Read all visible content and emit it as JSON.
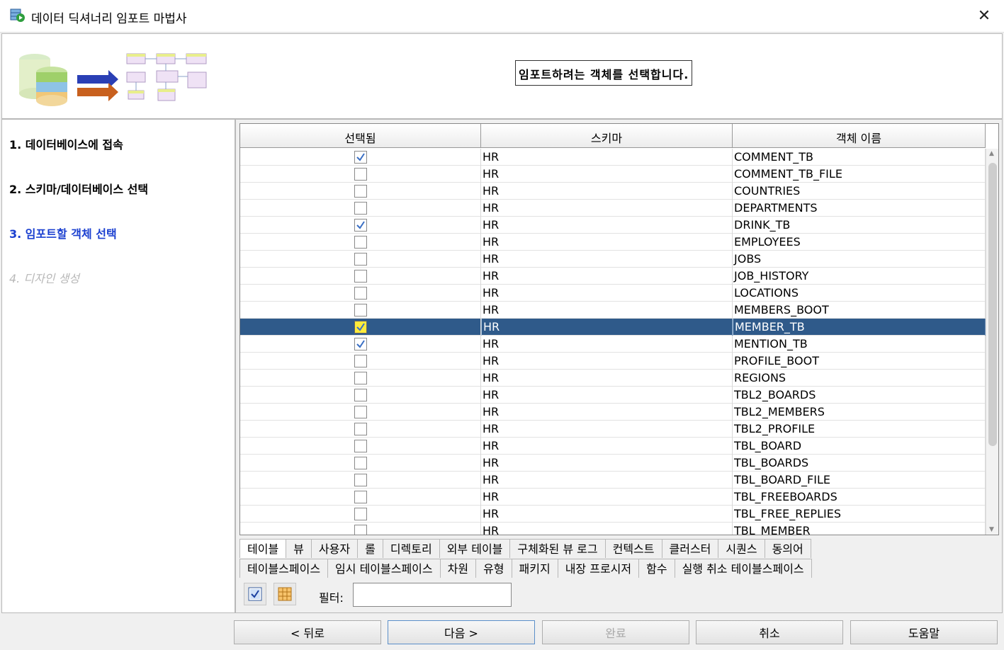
{
  "window": {
    "title": "데이터 딕셔너리 임포트 마법사"
  },
  "header": {
    "instruction": "임포트하려는 객체를 선택합니다."
  },
  "steps": [
    {
      "label": "1. 데이터베이스에 접속"
    },
    {
      "label": "2. 스키마/데이터베이스 선택"
    },
    {
      "label": "3. 임포트할 객체 선택"
    },
    {
      "label": "4. 디자인 생성"
    }
  ],
  "grid": {
    "columns": {
      "selected": "선택됨",
      "schema": "스키마",
      "name": "객체 이름"
    },
    "rows": [
      {
        "checked": true,
        "schema": "HR",
        "name": "COMMENT_TB"
      },
      {
        "checked": false,
        "schema": "HR",
        "name": "COMMENT_TB_FILE"
      },
      {
        "checked": false,
        "schema": "HR",
        "name": "COUNTRIES"
      },
      {
        "checked": false,
        "schema": "HR",
        "name": "DEPARTMENTS"
      },
      {
        "checked": true,
        "schema": "HR",
        "name": "DRINK_TB"
      },
      {
        "checked": false,
        "schema": "HR",
        "name": "EMPLOYEES"
      },
      {
        "checked": false,
        "schema": "HR",
        "name": "JOBS"
      },
      {
        "checked": false,
        "schema": "HR",
        "name": "JOB_HISTORY"
      },
      {
        "checked": false,
        "schema": "HR",
        "name": "LOCATIONS"
      },
      {
        "checked": false,
        "schema": "HR",
        "name": "MEMBERS_BOOT"
      },
      {
        "checked": true,
        "schema": "HR",
        "name": "MEMBER_TB",
        "selected": true
      },
      {
        "checked": true,
        "schema": "HR",
        "name": "MENTION_TB"
      },
      {
        "checked": false,
        "schema": "HR",
        "name": "PROFILE_BOOT"
      },
      {
        "checked": false,
        "schema": "HR",
        "name": "REGIONS"
      },
      {
        "checked": false,
        "schema": "HR",
        "name": "TBL2_BOARDS"
      },
      {
        "checked": false,
        "schema": "HR",
        "name": "TBL2_MEMBERS"
      },
      {
        "checked": false,
        "schema": "HR",
        "name": "TBL2_PROFILE"
      },
      {
        "checked": false,
        "schema": "HR",
        "name": "TBL_BOARD"
      },
      {
        "checked": false,
        "schema": "HR",
        "name": "TBL_BOARDS"
      },
      {
        "checked": false,
        "schema": "HR",
        "name": "TBL_BOARD_FILE"
      },
      {
        "checked": false,
        "schema": "HR",
        "name": "TBL_FREEBOARDS"
      },
      {
        "checked": false,
        "schema": "HR",
        "name": "TBL_FREE_REPLIES"
      },
      {
        "checked": false,
        "schema": "HR",
        "name": "TBL_MEMBER"
      }
    ]
  },
  "tabs_row1": [
    "테이블",
    "뷰",
    "사용자",
    "롤",
    "디렉토리",
    "외부 테이블",
    "구체화된 뷰 로그",
    "컨텍스트",
    "클러스터",
    "시퀀스",
    "동의어"
  ],
  "tabs_row2": [
    "테이블스페이스",
    "임시 테이블스페이스",
    "차원",
    "유형",
    "패키지",
    "내장 프로시저",
    "함수",
    "실행 취소 테이블스페이스"
  ],
  "filter": {
    "label": "필터:",
    "value": ""
  },
  "buttons": {
    "back": "< 뒤로",
    "next": "다음 >",
    "finish": "완료",
    "cancel": "취소",
    "help": "도움말"
  },
  "colors": {
    "selection": "#2f5a8a",
    "current_step": "#1a3fd0",
    "check": "#3a6fc4"
  },
  "icons": {
    "app": "wizard-app-icon",
    "close": "close-icon",
    "select_all": "check-all-icon",
    "deselect_all": "grid-icon"
  }
}
